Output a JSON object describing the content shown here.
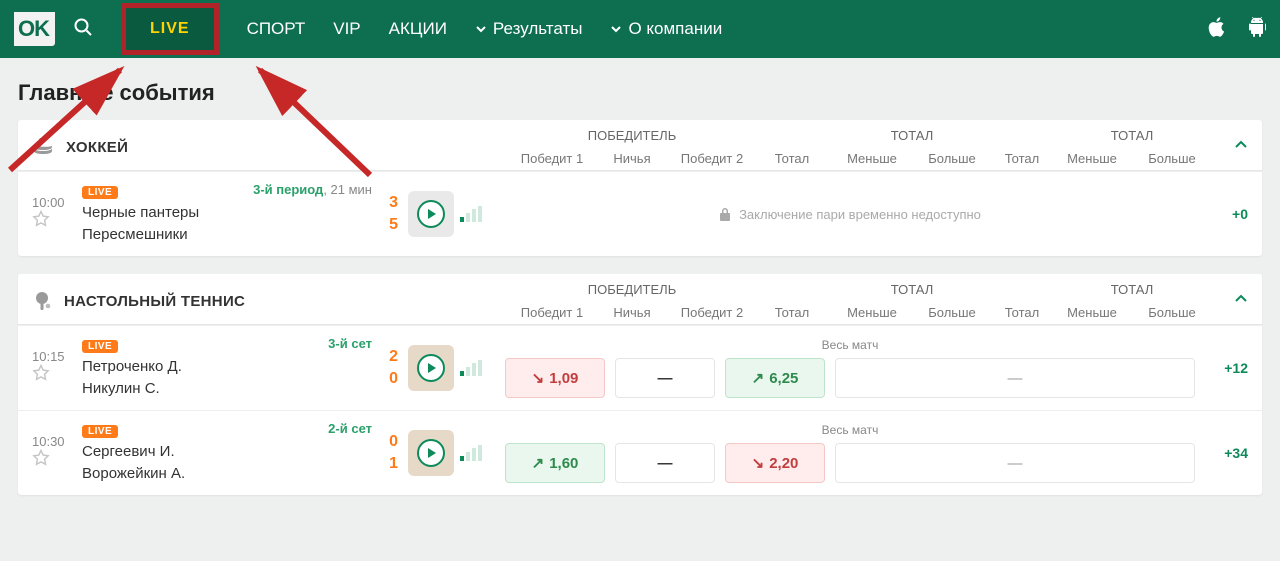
{
  "logo": "OK",
  "nav": {
    "live": "LIVE",
    "sport": "СПОРТ",
    "vip": "VIP",
    "promo": "АКЦИИ",
    "results": "Результаты",
    "about": "О компании"
  },
  "page_title": "Главные события",
  "columns": {
    "winner": "ПОБЕДИТЕЛЬ",
    "win1": "Победит 1",
    "draw": "Ничья",
    "win2": "Победит 2",
    "total": "Тотал",
    "total_label": "ТОТАЛ",
    "under": "Меньше",
    "over": "Больше"
  },
  "sports": [
    {
      "name": "ХОККЕЙ",
      "icon": "hockey",
      "matches": [
        {
          "time": "10:00",
          "live": "LIVE",
          "period_green": "3-й период",
          "period_rest": ", 21 мин",
          "team1": "Черные пантеры",
          "team2": "Пересмешники",
          "score1": "3",
          "score2": "5",
          "locked_text": "Заключение пари временно недоступно",
          "more": "+0"
        }
      ]
    },
    {
      "name": "НАСТОЛЬНЫЙ ТЕННИС",
      "icon": "pingpong",
      "matches": [
        {
          "time": "10:15",
          "live": "LIVE",
          "period_green": "3-й сет",
          "period_rest": "",
          "team1": "Петроченко Д.",
          "team2": "Никулин С.",
          "score1": "2",
          "score2": "0",
          "odds_label": "Весь матч",
          "odd1": "1,09",
          "odd1_dir": "down",
          "odd_draw": "—",
          "odd2": "6,25",
          "odd2_dir": "up",
          "more": "+12"
        },
        {
          "time": "10:30",
          "live": "LIVE",
          "period_green": "2-й сет",
          "period_rest": "",
          "team1": "Сергеевич И.",
          "team2": "Ворожейкин А.",
          "score1": "0",
          "score2": "1",
          "odds_label": "Весь матч",
          "odd1": "1,60",
          "odd1_dir": "up",
          "odd_draw": "—",
          "odd2": "2,20",
          "odd2_dir": "down",
          "more": "+34"
        }
      ]
    }
  ]
}
